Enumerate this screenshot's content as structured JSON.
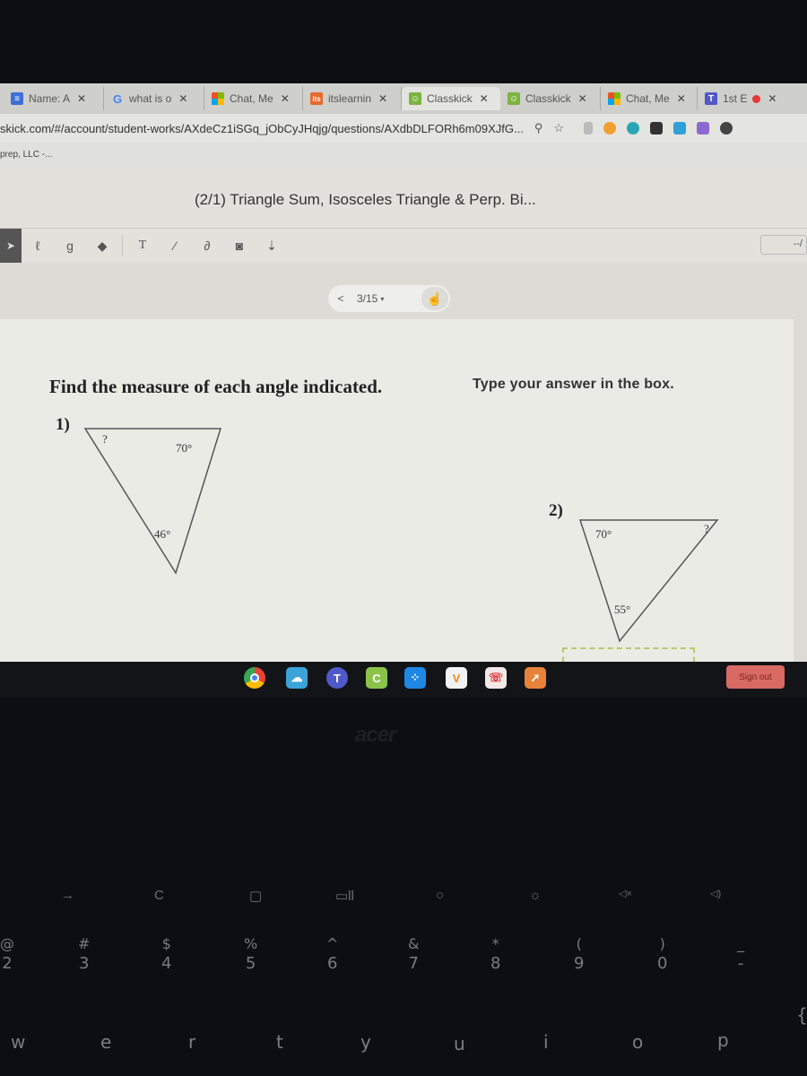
{
  "browser": {
    "tabs": [
      {
        "label": "Name: A",
        "icon": "google-docs-icon"
      },
      {
        "label": "what is o",
        "icon": "google-icon"
      },
      {
        "label": "Chat, Me",
        "icon": "microsoft-icon"
      },
      {
        "label": "itslearnin",
        "icon": "itslearning-icon"
      },
      {
        "label": "Classkick",
        "icon": "classkick-icon",
        "active": true
      },
      {
        "label": "Classkick",
        "icon": "classkick-icon"
      },
      {
        "label": "Chat, Me",
        "icon": "microsoft-icon"
      },
      {
        "label": "1st E",
        "icon": "teams-icon",
        "recording": true
      }
    ],
    "close_glyph": "✕",
    "url": "skick.com/#/account/student-works/AXdeCz1iSGq_jObCyJHqjg/questions/AXdbDLFORh6m09XJfG...",
    "bookmark": "prep, LLC -..."
  },
  "app": {
    "title": "(2/1) Triangle Sum, Isosceles Triangle & Perp. Bi...",
    "page_counter": "--/",
    "pager": {
      "current": "3/15",
      "prev_glyph": "<",
      "caret_glyph": "▾"
    },
    "tools": [
      "pen-icon",
      "highlighter-icon",
      "eraser-icon",
      "text-tool-icon",
      "line-tool-icon",
      "link-icon",
      "camera-icon",
      "microphone-icon"
    ],
    "tool_glyphs": [
      "ℓ",
      "ɡ",
      "◆",
      "T",
      "⁄",
      "∂",
      "◙",
      "⇣"
    ]
  },
  "worksheet": {
    "instructions": "Find the measure of each angle indicated.",
    "hint": "Type your answer in the box.",
    "problems": [
      {
        "number": "1)",
        "angles": {
          "top_left": "?",
          "top_right": "70°",
          "bottom": "46°"
        },
        "answer": ""
      },
      {
        "number": "2)",
        "angles": {
          "top_left": "70°",
          "top_right": "?",
          "bottom": "55°"
        },
        "answer": ""
      }
    ]
  },
  "shelf": {
    "apps": [
      {
        "name": "chrome",
        "color": "#e8453c"
      },
      {
        "name": "cloud-app",
        "color": "#3ba4d8"
      },
      {
        "name": "teams",
        "color": "#5059c9"
      },
      {
        "name": "classkick",
        "color": "#8bc34a",
        "glyph": "C"
      },
      {
        "name": "dots-app",
        "color": "#1e88e5"
      },
      {
        "name": "v-app",
        "color": "#f0f0f0"
      },
      {
        "name": "phone-app",
        "color": "#f2e6e6"
      },
      {
        "name": "rocket-app",
        "color": "#e8823a"
      }
    ],
    "signout_label": "Sign out"
  },
  "device": {
    "brand": "acer",
    "fn_keys": [
      "→",
      "C",
      "▢",
      "▭ll",
      "○",
      "☼",
      "◁×",
      "◁)"
    ],
    "number_keys": [
      {
        "top": "@",
        "bot": "2"
      },
      {
        "top": "#",
        "bot": "3"
      },
      {
        "top": "$",
        "bot": "4"
      },
      {
        "top": "%",
        "bot": "5"
      },
      {
        "top": "^",
        "bot": "6"
      },
      {
        "top": "&",
        "bot": "7"
      },
      {
        "top": "*",
        "bot": "8"
      },
      {
        "top": "(",
        "bot": "9"
      },
      {
        "top": ")",
        "bot": "0"
      },
      {
        "top": "_",
        "bot": "-"
      }
    ],
    "letter_keys": [
      "w",
      "e",
      "r",
      "t",
      "y",
      "u",
      "i",
      "o",
      "p",
      "{"
    ]
  }
}
